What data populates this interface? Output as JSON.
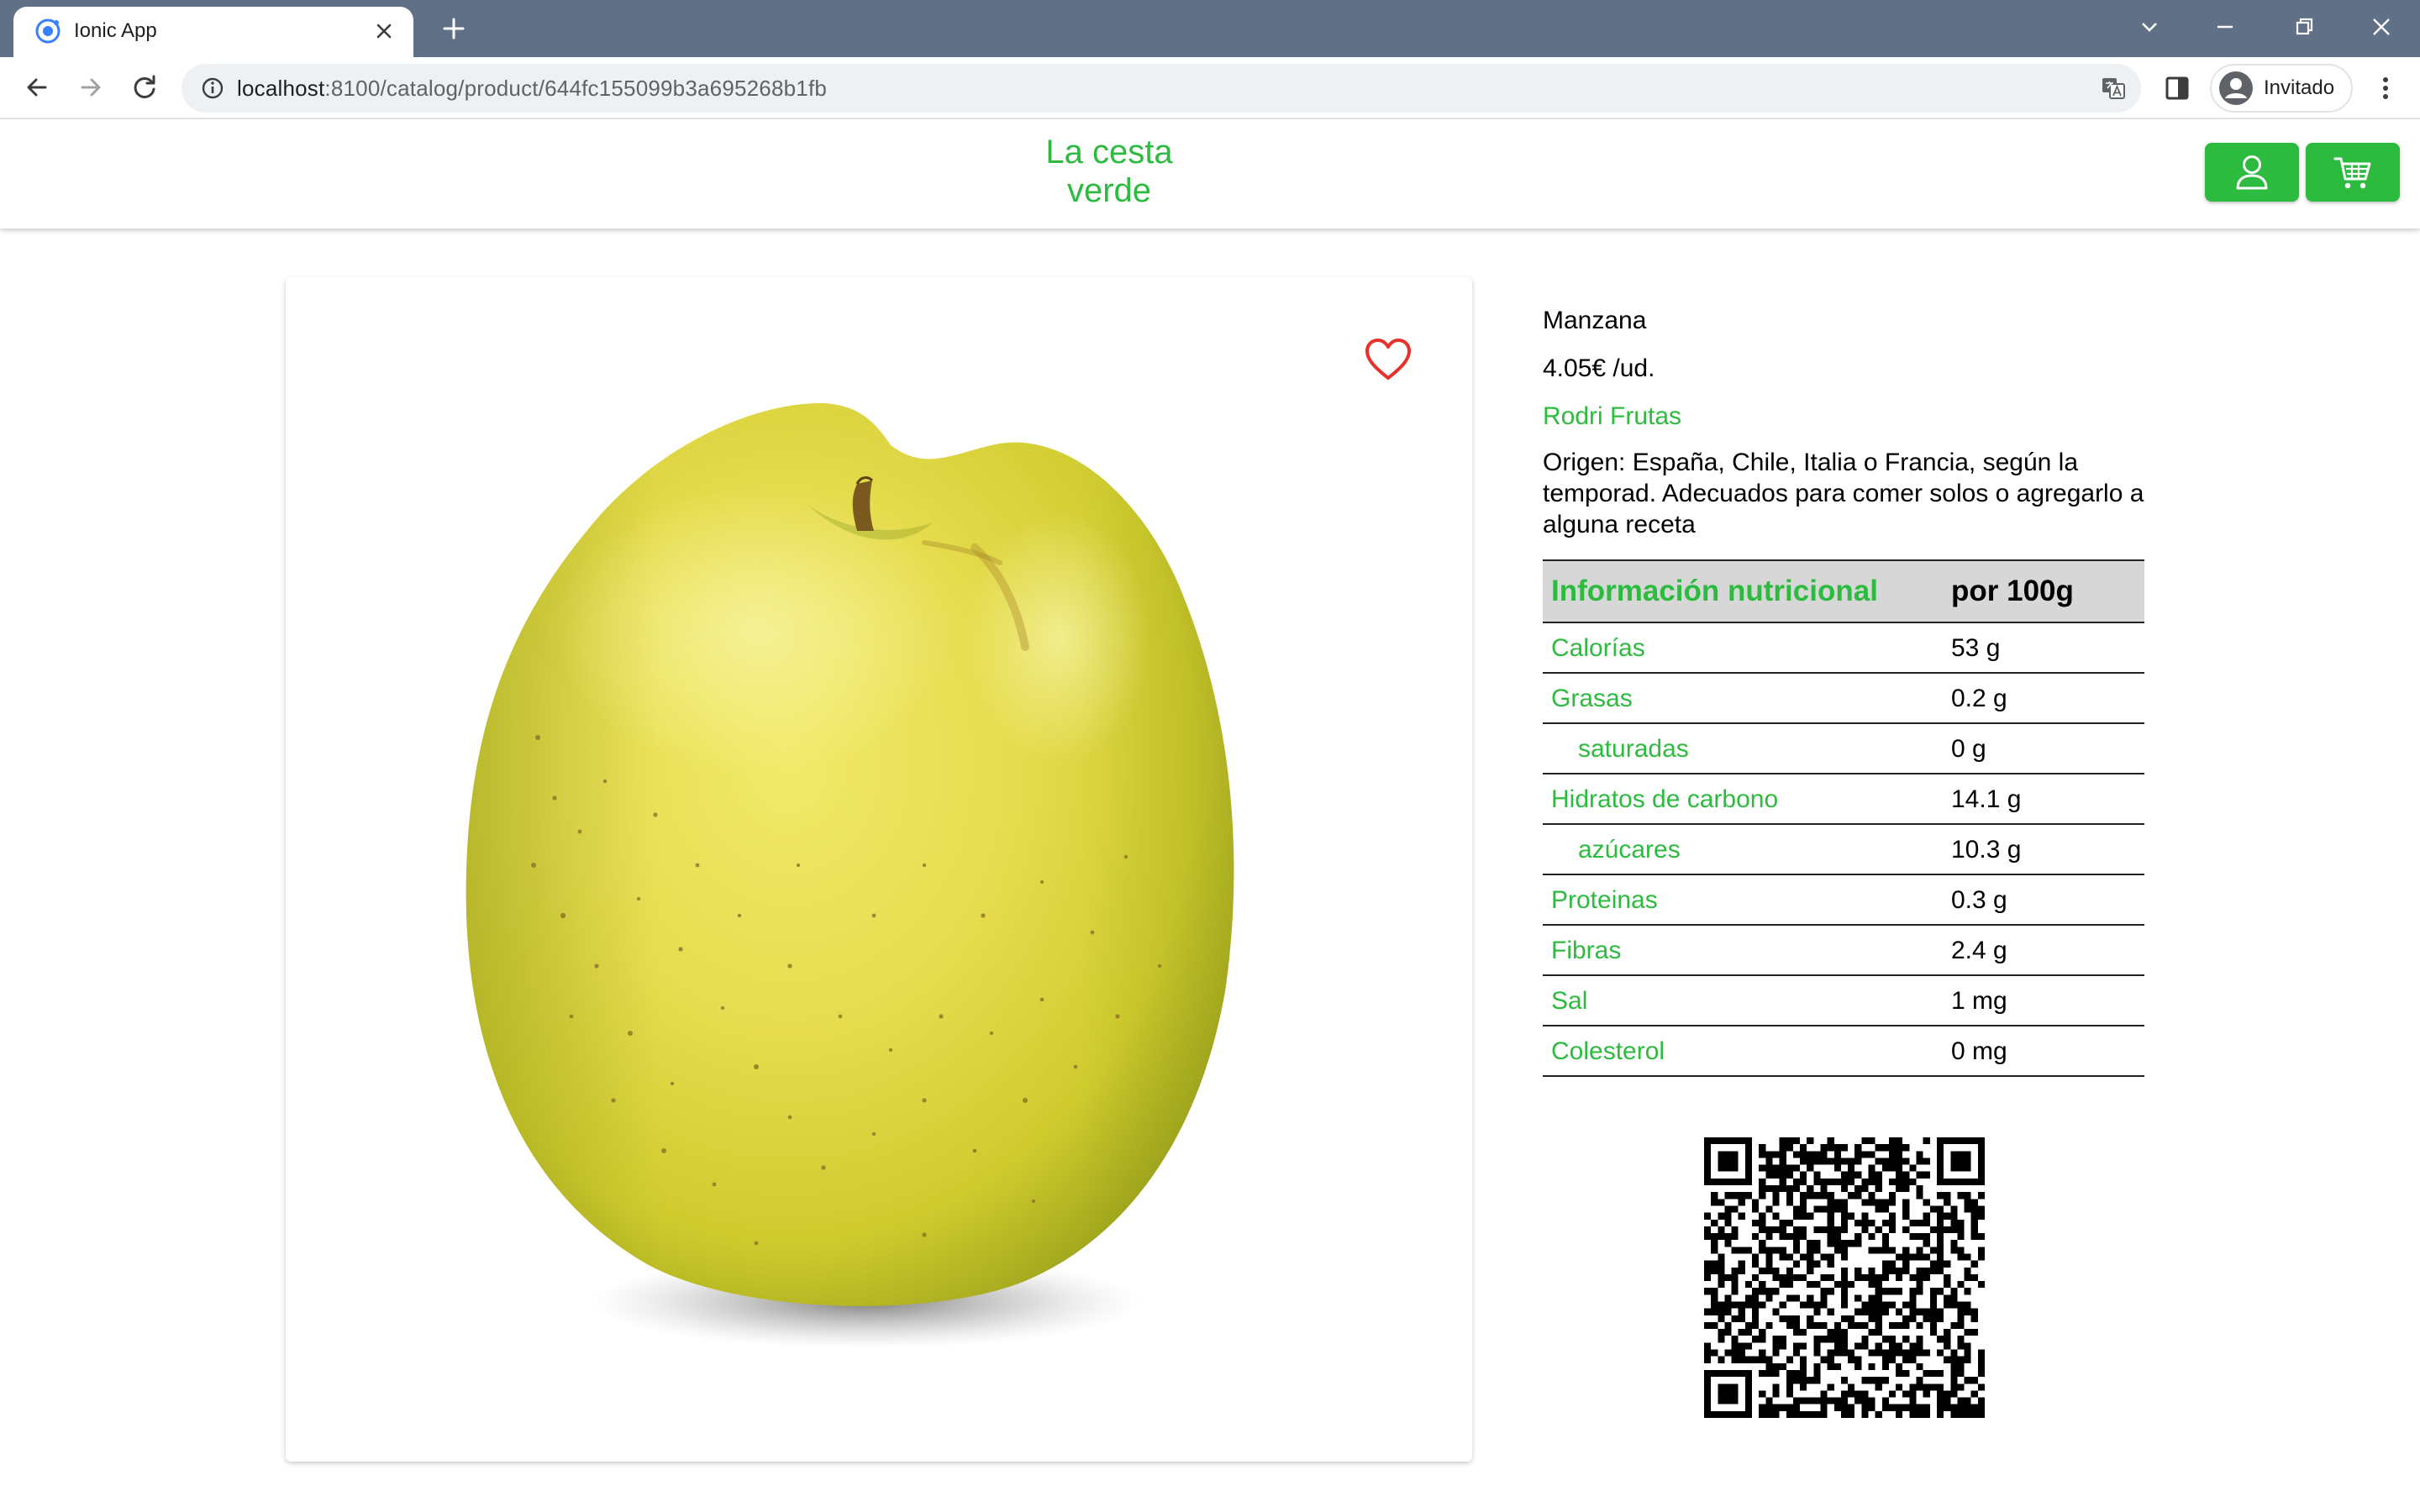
{
  "browser": {
    "tab_title": "Ionic App",
    "url_host": "localhost",
    "url_path": ":8100/catalog/product/644fc155099b3a695268b1fb",
    "profile_label": "Invitado"
  },
  "app": {
    "title": "La cesta\nverde",
    "brand_color": "#2dbb3f"
  },
  "product": {
    "name": "Manzana",
    "price": "4.05€ /ud.",
    "seller": "Rodri Frutas",
    "description": "Origen: España, Chile, Italia o Francia, según la temporad. Adecuados para comer solos o agregarlo a alguna receta",
    "favorite": false
  },
  "nutrition": {
    "header_label": "Información nutricional",
    "header_value": "por 100g",
    "rows": [
      {
        "label": "Calorías",
        "value": "53 g"
      },
      {
        "label": "Grasas",
        "value": "0.2 g"
      },
      {
        "label": "saturadas",
        "value": "0 g"
      },
      {
        "label": "Hidratos de carbono",
        "value": "14.1 g"
      },
      {
        "label": "azúcares",
        "value": "10.3 g"
      },
      {
        "label": "Proteinas",
        "value": "0.3 g"
      },
      {
        "label": "Fibras",
        "value": "2.4 g"
      },
      {
        "label": "Sal",
        "value": "1 mg"
      },
      {
        "label": "Colesterol",
        "value": "0 mg"
      }
    ]
  },
  "icons": {
    "tab_favicon": "ionic-logo-icon",
    "favorite": "heart-outline-icon",
    "user": "person-icon",
    "cart": "cart-icon"
  }
}
